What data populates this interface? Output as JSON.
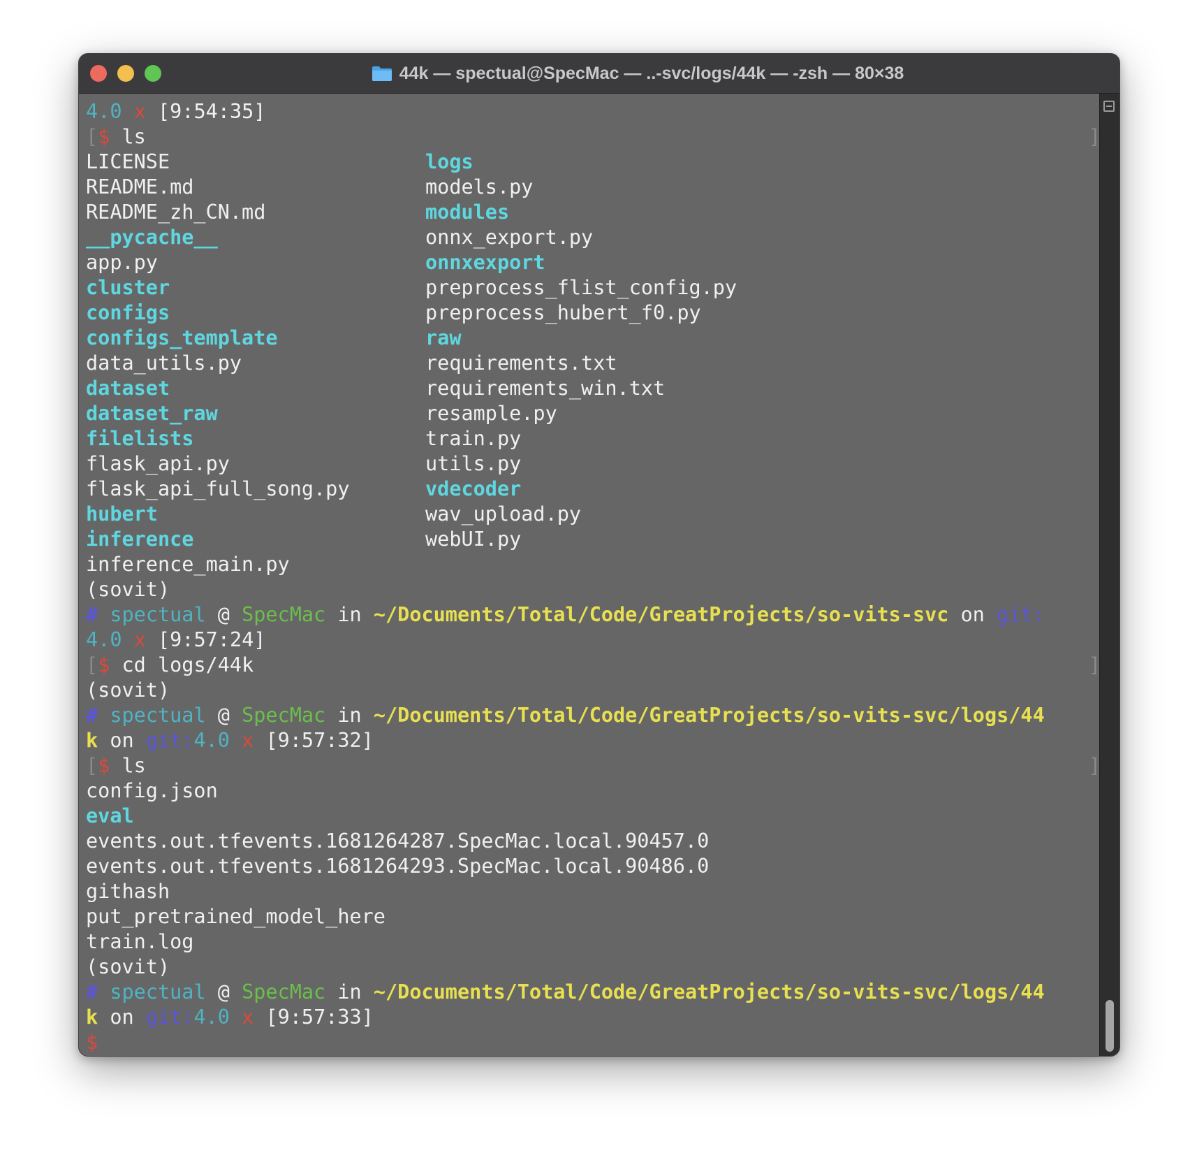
{
  "window": {
    "title": "44k — spectual@SpecMac — ..-svc/logs/44k — -zsh — 80×38",
    "colors": {
      "close": "#ec6a5e",
      "minimize": "#f4bf4f",
      "maximize": "#61c554",
      "background": "#666666"
    }
  },
  "terminal": {
    "line1": {
      "version": "4.0",
      "x": "x",
      "time": "[9:54:35]"
    },
    "cmd1": {
      "bracket": "[",
      "dollar": "$",
      "command": " ls",
      "end": "]"
    },
    "listing1": [
      [
        {
          "text": "LICENSE",
          "dir": false
        },
        {
          "text": "logs",
          "dir": true
        }
      ],
      [
        {
          "text": "README.md",
          "dir": false
        },
        {
          "text": "models.py",
          "dir": false
        }
      ],
      [
        {
          "text": "README_zh_CN.md",
          "dir": false
        },
        {
          "text": "modules",
          "dir": true
        }
      ],
      [
        {
          "text": "__pycache__",
          "dir": true
        },
        {
          "text": "onnx_export.py",
          "dir": false
        }
      ],
      [
        {
          "text": "app.py",
          "dir": false
        },
        {
          "text": "onnxexport",
          "dir": true
        }
      ],
      [
        {
          "text": "cluster",
          "dir": true
        },
        {
          "text": "preprocess_flist_config.py",
          "dir": false
        }
      ],
      [
        {
          "text": "configs",
          "dir": true
        },
        {
          "text": "preprocess_hubert_f0.py",
          "dir": false
        }
      ],
      [
        {
          "text": "configs_template",
          "dir": true
        },
        {
          "text": "raw",
          "dir": true
        }
      ],
      [
        {
          "text": "data_utils.py",
          "dir": false
        },
        {
          "text": "requirements.txt",
          "dir": false
        }
      ],
      [
        {
          "text": "dataset",
          "dir": true
        },
        {
          "text": "requirements_win.txt",
          "dir": false
        }
      ],
      [
        {
          "text": "dataset_raw",
          "dir": true
        },
        {
          "text": "resample.py",
          "dir": false
        }
      ],
      [
        {
          "text": "filelists",
          "dir": true
        },
        {
          "text": "train.py",
          "dir": false
        }
      ],
      [
        {
          "text": "flask_api.py",
          "dir": false
        },
        {
          "text": "utils.py",
          "dir": false
        }
      ],
      [
        {
          "text": "flask_api_full_song.py",
          "dir": false
        },
        {
          "text": "vdecoder",
          "dir": true
        }
      ],
      [
        {
          "text": "hubert",
          "dir": true
        },
        {
          "text": "wav_upload.py",
          "dir": false
        }
      ],
      [
        {
          "text": "inference",
          "dir": true
        },
        {
          "text": "webUI.py",
          "dir": false
        }
      ],
      [
        {
          "text": "inference_main.py",
          "dir": false
        },
        {
          "text": "",
          "dir": false
        }
      ]
    ],
    "env": "(sovit)",
    "prompt1": {
      "hash": "#",
      "user": "spectual",
      "at": " @ ",
      "host": "SpecMac",
      "in": " in ",
      "path": "~/Documents/Total/Code/GreatProjects/so-vits-svc",
      "on": " on ",
      "git": "git:",
      "version": "4.0",
      "x": "x",
      "time": "[9:57:24]"
    },
    "cmd2": {
      "bracket": "[",
      "dollar": "$",
      "command": " cd logs/44k",
      "end": "]"
    },
    "prompt2": {
      "hash": "#",
      "user": "spectual",
      "at": " @ ",
      "host": "SpecMac",
      "in": " in ",
      "path": "~/Documents/Total/Code/GreatProjects/so-vits-svc/logs/44",
      "path_wrap": "k",
      "on": " on ",
      "git": "git:",
      "version": "4.0",
      "x": "x",
      "time": "[9:57:32]"
    },
    "cmd3": {
      "bracket": "[",
      "dollar": "$",
      "command": " ls",
      "end": "]"
    },
    "listing2": [
      {
        "text": "config.json",
        "dir": false
      },
      {
        "text": "eval",
        "dir": true
      },
      {
        "text": "events.out.tfevents.1681264287.SpecMac.local.90457.0",
        "dir": false
      },
      {
        "text": "events.out.tfevents.1681264293.SpecMac.local.90486.0",
        "dir": false
      },
      {
        "text": "githash",
        "dir": false
      },
      {
        "text": "put_pretrained_model_here",
        "dir": false
      },
      {
        "text": "train.log",
        "dir": false
      }
    ],
    "prompt3": {
      "hash": "#",
      "user": "spectual",
      "at": " @ ",
      "host": "SpecMac",
      "in": " in ",
      "path": "~/Documents/Total/Code/GreatProjects/so-vits-svc/logs/44",
      "path_wrap": "k",
      "on": " on ",
      "git": "git:",
      "version": "4.0",
      "x": "x",
      "time": "[9:57:33]"
    },
    "final_prompt": "$"
  }
}
